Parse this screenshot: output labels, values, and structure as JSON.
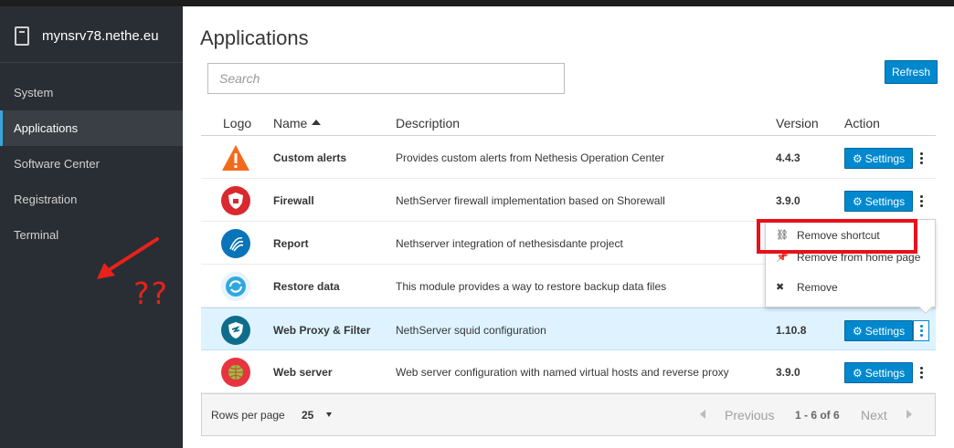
{
  "sidebar": {
    "hostname": "mynsrv78.nethe.eu",
    "items": [
      {
        "label": "System"
      },
      {
        "label": "Applications",
        "active": true
      },
      {
        "label": "Software Center"
      },
      {
        "label": "Registration"
      },
      {
        "label": "Terminal"
      }
    ]
  },
  "annotation": {
    "text": "??",
    "color": "#e8221a"
  },
  "main": {
    "title": "Applications",
    "search_placeholder": "Search",
    "refresh_label": "Refresh"
  },
  "table": {
    "columns": [
      "Logo",
      "Name",
      "Description",
      "Version",
      "Action"
    ],
    "sort_column": "Name",
    "rows": [
      {
        "name": "Custom alerts",
        "description": "Provides custom alerts from Nethesis Operation Center",
        "version": "4.4.3",
        "settings": "Settings",
        "logo": "warning-triangle-icon"
      },
      {
        "name": "Firewall",
        "description": "NethServer firewall implementation based on Shorewall",
        "version": "3.9.0",
        "settings": "Settings",
        "logo": "firewall-shield-icon"
      },
      {
        "name": "Report",
        "description": "Nethserver integration of nethesisdante project",
        "version": "",
        "settings": "",
        "logo": "report-swirl-icon"
      },
      {
        "name": "Restore data",
        "description": "This module provides a way to restore backup data files",
        "version": "",
        "settings": "",
        "logo": "restore-arrows-icon"
      },
      {
        "name": "Web Proxy & Filter",
        "description": "NethServer squid configuration",
        "version": "1.10.8",
        "settings": "Settings",
        "logo": "proxy-shield-icon",
        "highlighted": true
      },
      {
        "name": "Web server",
        "description": "Web server configuration with named virtual hosts and reverse proxy",
        "version": "3.9.0",
        "settings": "Settings",
        "logo": "web-globe-icon"
      }
    ]
  },
  "context_menu": {
    "items": [
      {
        "label": "Remove shortcut",
        "icon": "unlink-icon"
      },
      {
        "label": "Remove from home page",
        "icon": "pin-icon"
      },
      {
        "label": "Remove",
        "icon": "close-icon"
      }
    ]
  },
  "pager": {
    "rows_per_page_label": "Rows per page",
    "rows_per_page_value": "25",
    "previous_label": "Previous",
    "count_label": "1 - 6 of 6",
    "next_label": "Next"
  },
  "colors": {
    "accent": "#0088ce",
    "sidebar": "#292e34",
    "highlight_row": "#def3ff",
    "annotation": "#e8101a"
  }
}
